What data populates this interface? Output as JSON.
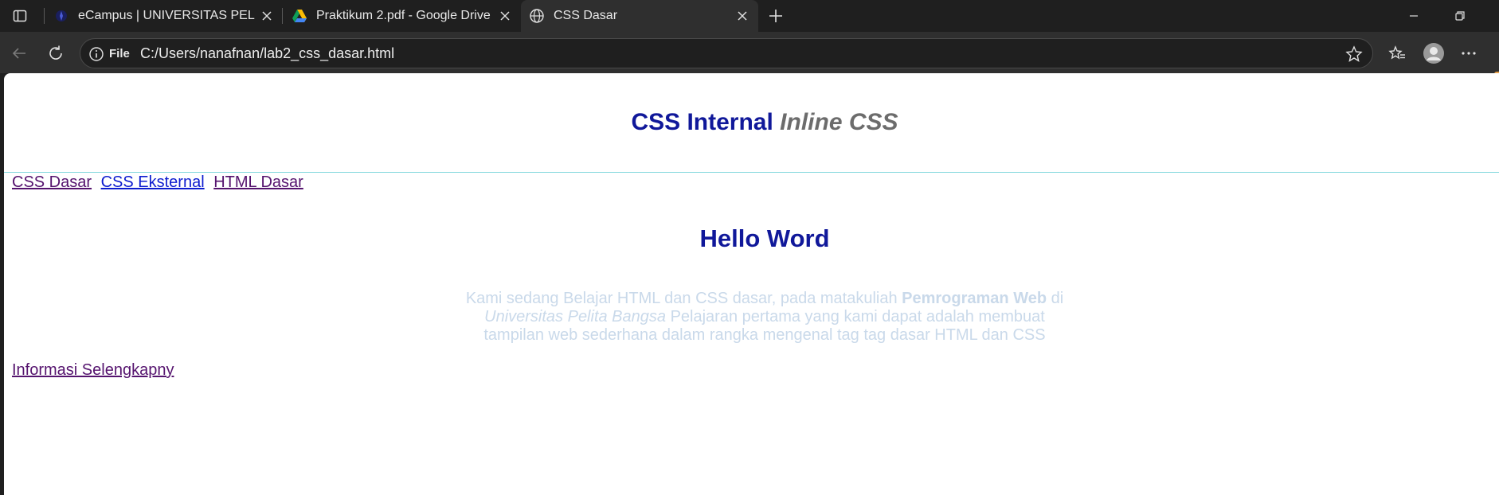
{
  "tabs": [
    {
      "title": "eCampus | UNIVERSITAS PELITA BANGSA",
      "favicon": "ecampus-icon",
      "active": false
    },
    {
      "title": "Praktikum 2.pdf - Google Drive",
      "favicon": "google-drive-icon",
      "active": false
    },
    {
      "title": "CSS Dasar",
      "favicon": "globe-icon",
      "active": true
    }
  ],
  "toolbar": {
    "scheme_label": "File",
    "url": "C:/Users/nanafnan/lab2_css_dasar.html"
  },
  "page": {
    "header_part1": "CSS Internal",
    "header_part2": "Inline CSS",
    "nav": [
      "CSS Dasar",
      "CSS Eksternal",
      "HTML Dasar"
    ],
    "heading": "Hello Word",
    "paragraph": {
      "text1": "Kami sedang Belajar HTML dan CSS dasar, pada matakuliah ",
      "bold": "Pemrograman Web",
      "text2": " di ",
      "italic": "Universitas Pelita Bangsa",
      "text3": " Pelajaran pertama yang kami dapat adalah membuat tampilan web sederhana dalam rangka mengenal tag tag dasar HTML dan CSS"
    },
    "more_link": "Informasi Selengkapny"
  },
  "colors": {
    "heading_blue": "#10189a",
    "paragraph_text": "#c9d9ea",
    "visited_link": "#55136e",
    "link": "#0d1ccf"
  }
}
